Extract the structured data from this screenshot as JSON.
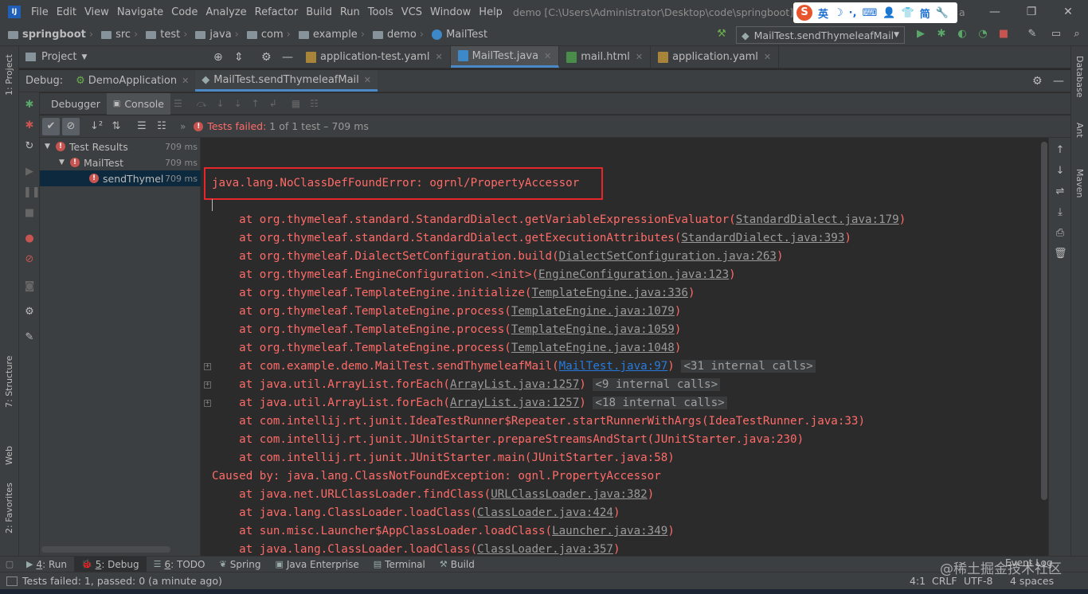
{
  "menubar": {
    "app_icon": "intellij-icon",
    "items": [
      "File",
      "Edit",
      "View",
      "Navigate",
      "Code",
      "Analyze",
      "Refactor",
      "Build",
      "Run",
      "Tools",
      "VCS",
      "Window",
      "Help"
    ],
    "title": "demo [C:\\Users\\Administrator\\Desktop\\code\\springboot] - ...\\ja",
    "title_tail": "a",
    "ime": {
      "s": "S",
      "lang": "英",
      "moon": "☽",
      "dot": "·,",
      "kbd": "⌨",
      "person": "👤",
      "shirt": "👕",
      "simp": "简",
      "wrench": "🔧"
    }
  },
  "navbar": {
    "crumbs": [
      "springboot",
      "src",
      "test",
      "java",
      "com",
      "example",
      "demo",
      "MailTest"
    ],
    "run_config": "MailTest.sendThymeleafMail"
  },
  "left_strip": {
    "project": "1: Project",
    "structure": "7: Structure",
    "web": "Web",
    "favorites": "2: Favorites"
  },
  "right_strip": {
    "database": "Database",
    "ant": "Ant",
    "maven": "Maven"
  },
  "project_panel": {
    "label": "Project"
  },
  "editor_tabs": [
    {
      "label": "application-test.yaml",
      "active": false
    },
    {
      "label": "MailTest.java",
      "active": true
    },
    {
      "label": "mail.html",
      "active": false
    },
    {
      "label": "application.yaml",
      "active": false
    }
  ],
  "debug": {
    "label": "Debug:",
    "tabs": [
      {
        "label": "DemoApplication"
      },
      {
        "label": "MailTest.sendThymeleafMail"
      }
    ],
    "subtabs": {
      "debugger": "Debugger",
      "console": "Console"
    },
    "test_status": "Tests failed:",
    "test_status_detail": "1 of 1 test – 709 ms"
  },
  "test_tree": [
    {
      "label": "Test Results",
      "time": "709 ms"
    },
    {
      "label": "MailTest",
      "time": "709 ms"
    },
    {
      "label": "sendThymeleafMail",
      "label_shown": "sendThymelea",
      "time": "709 ms"
    }
  ],
  "console": {
    "error": "java.lang.NoClassDefFoundError: ogrnl/PropertyAccessor",
    "lines": [
      {
        "pre": "    at org.thymeleaf.standard.StandardDialect.getVariableExpressionEvaluator(",
        "link": "StandardDialect.java:179",
        "post": ")"
      },
      {
        "pre": "    at org.thymeleaf.standard.StandardDialect.getExecutionAttributes(",
        "link": "StandardDialect.java:393",
        "post": ")"
      },
      {
        "pre": "    at org.thymeleaf.DialectSetConfiguration.build(",
        "link": "DialectSetConfiguration.java:263",
        "post": ")"
      },
      {
        "pre": "    at org.thymeleaf.EngineConfiguration.<init>(",
        "link": "EngineConfiguration.java:123",
        "post": ")"
      },
      {
        "pre": "    at org.thymeleaf.TemplateEngine.initialize(",
        "link": "TemplateEngine.java:336",
        "post": ")"
      },
      {
        "pre": "    at org.thymeleaf.TemplateEngine.process(",
        "link": "TemplateEngine.java:1079",
        "post": ")"
      },
      {
        "pre": "    at org.thymeleaf.TemplateEngine.process(",
        "link": "TemplateEngine.java:1059",
        "post": ")"
      },
      {
        "pre": "    at org.thymeleaf.TemplateEngine.process(",
        "link": "TemplateEngine.java:1048",
        "post": ")"
      },
      {
        "pre": "    at com.example.demo.MailTest.sendThymeleafMail(",
        "link": "MailTest.java:97",
        "post": ")",
        "internal": "<31 internal calls>",
        "blue": true,
        "fold": true
      },
      {
        "pre": "    at java.util.ArrayList.forEach(",
        "link": "ArrayList.java:1257",
        "post": ")",
        "internal": "<9 internal calls>",
        "fold": true
      },
      {
        "pre": "    at java.util.ArrayList.forEach(",
        "link": "ArrayList.java:1257",
        "post": ")",
        "internal": "<18 internal calls>",
        "fold": true
      },
      {
        "pre": "    at com.intellij.rt.junit.IdeaTestRunner$Repeater.startRunnerWithArgs(IdeaTestRunner.java:33)"
      },
      {
        "pre": "    at com.intellij.rt.junit.JUnitStarter.prepareStreamsAndStart(JUnitStarter.java:230)"
      },
      {
        "pre": "    at com.intellij.rt.junit.JUnitStarter.main(JUnitStarter.java:58)"
      },
      {
        "pre": "Caused by: java.lang.ClassNotFoundException: ognl.PropertyAccessor"
      },
      {
        "pre": "    at java.net.URLClassLoader.findClass(",
        "link": "URLClassLoader.java:382",
        "post": ")"
      },
      {
        "pre": "    at java.lang.ClassLoader.loadClass(",
        "link": "ClassLoader.java:424",
        "post": ")"
      },
      {
        "pre": "    at sun.misc.Launcher$AppClassLoader.loadClass(",
        "link": "Launcher.java:349",
        "post": ")"
      },
      {
        "pre": "    at java.lang.ClassLoader.loadClass(",
        "link": "ClassLoader.java:357",
        "post": ")"
      }
    ]
  },
  "bottom_tabs": [
    {
      "icon": "▶",
      "num": "4",
      "label": ": Run",
      "active": false
    },
    {
      "icon": "🐞",
      "num": "5",
      "label": ": Debug",
      "active": true
    },
    {
      "icon": "☰",
      "num": "6",
      "label": ": TODO",
      "active": false
    },
    {
      "icon": "❦",
      "num": "",
      "label": "Spring",
      "active": false
    },
    {
      "icon": "▣",
      "num": "",
      "label": "Java Enterprise",
      "active": false
    },
    {
      "icon": "▤",
      "num": "",
      "label": "Terminal",
      "active": false
    },
    {
      "icon": "⚒",
      "num": "",
      "label": "Build",
      "active": false
    }
  ],
  "event_log": "Event Log",
  "status": {
    "message": "Tests failed: 1, passed: 0 (a minute ago)",
    "position": "4:1",
    "line_sep": "CRLF",
    "encoding": "UTF-8",
    "indent": "4 spaces"
  },
  "watermark": "@稀土掘金技术社区",
  "colors": {
    "error": "#ff6b68",
    "link_blue": "#287bde",
    "accent": "#4a88c7",
    "highlight_box": "#e6262a"
  }
}
